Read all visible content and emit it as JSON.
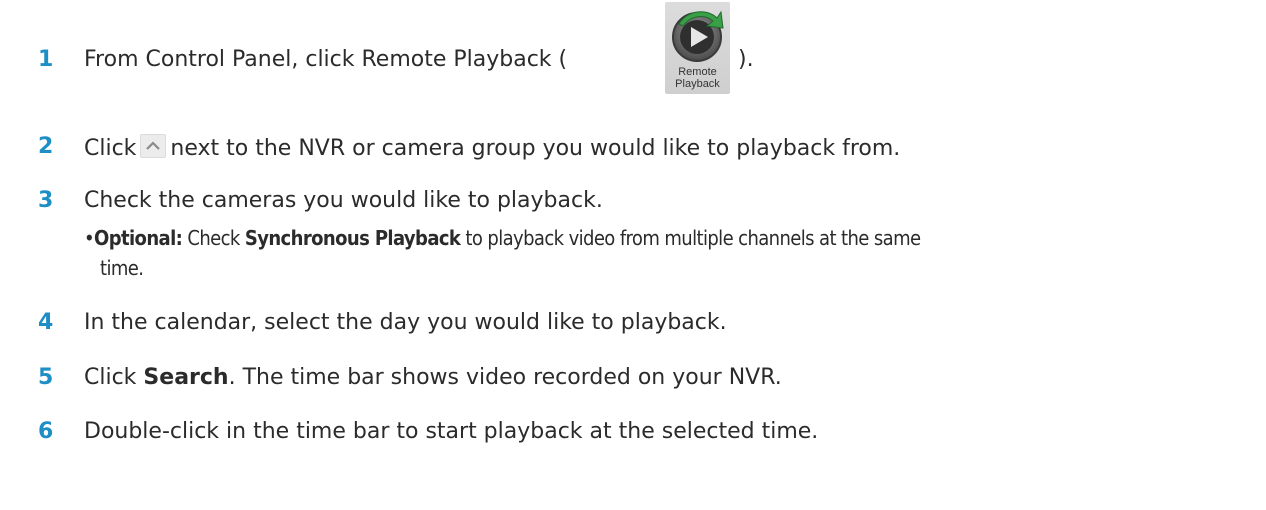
{
  "steps": [
    {
      "num": "1",
      "text_before": "From Control Panel, click Remote Playback (",
      "text_after": ").",
      "icon": {
        "name": "remote-playback-icon",
        "caption_line1": "Remote",
        "caption_line2": "Playback"
      }
    },
    {
      "num": "2",
      "text_before": "Click",
      "text_after": "next to the NVR or camera group you would like to playback from.",
      "icon": {
        "name": "chevron-up-icon"
      }
    },
    {
      "num": "3",
      "text": "Check the cameras you would like to playback.",
      "bullet": {
        "label": "Optional:",
        "pre": "Check",
        "bold": "Synchronous Playback",
        "post": "to playback video from multiple channels at the same",
        "continuation": "time."
      }
    },
    {
      "num": "4",
      "text": "In the calendar, select the day you would like to playback."
    },
    {
      "num": "5",
      "pre": "Click",
      "bold": "Search",
      "post": ". The time bar shows video recorded on your NVR."
    },
    {
      "num": "6",
      "text": "Double-click in the time bar to start playback at the selected time."
    }
  ],
  "colors": {
    "step_number": "#1e8fc6",
    "body_text": "#2b2b2b"
  }
}
